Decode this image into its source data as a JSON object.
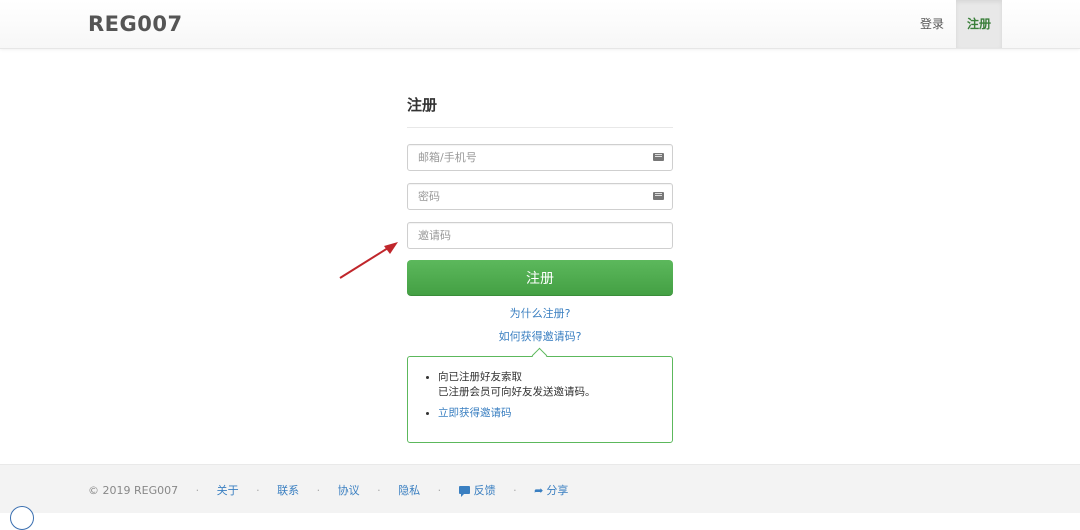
{
  "header": {
    "brand": "REG007",
    "nav": {
      "login": "登录",
      "register": "注册"
    }
  },
  "form": {
    "title": "注册",
    "email_placeholder": "邮箱/手机号",
    "password_placeholder": "密码",
    "invite_placeholder": "邀请码",
    "submit_label": "注册",
    "why_link": "为什么注册?",
    "how_link": "如何获得邀请码?"
  },
  "info": {
    "item1_line1": "向已注册好友索取",
    "item1_line2": "已注册会员可向好友发送邀请码。",
    "item2": "立即获得邀请码"
  },
  "footer": {
    "copyright": "© 2019 REG007",
    "links": {
      "about": "关于",
      "contact": "联系",
      "agreement": "协议",
      "privacy": "隐私",
      "feedback": "反馈",
      "share": "分享"
    },
    "separator": "·"
  },
  "colors": {
    "accent_green": "#5cb85c",
    "link_blue": "#3a7fc1",
    "annotation_arrow": "#c0262b"
  },
  "icons": {
    "field_icon": "keyboard-icon",
    "feedback": "comment-icon",
    "share": "share-arrow-icon",
    "annotation": "red-arrow-icon"
  }
}
